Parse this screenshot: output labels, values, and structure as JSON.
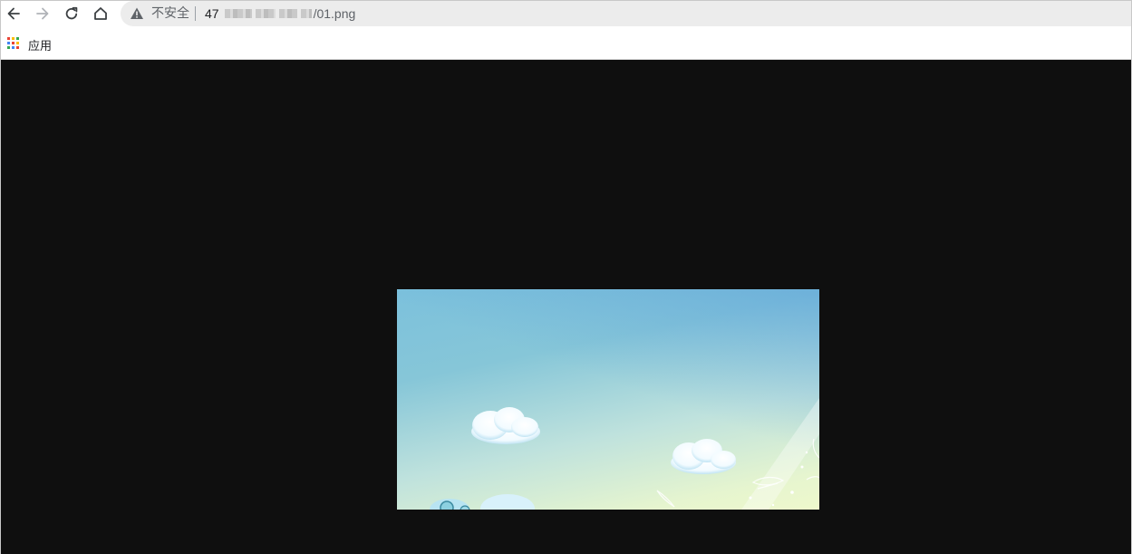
{
  "browser": {
    "nav": {
      "back_icon": "arrow-left-icon",
      "forward_icon": "arrow-right-icon",
      "reload_icon": "reload-icon",
      "home_icon": "home-icon"
    },
    "omnibox": {
      "security_icon": "warning-triangle-icon",
      "security_label": "不安全",
      "url_prefix": "47",
      "url_suffix": "/01.png"
    },
    "bookmarks": {
      "apps_icon": "apps-grid-icon",
      "apps_label": "应用"
    }
  },
  "colors": {
    "viewer_background": "#0f0f0f",
    "toolbar_background": "#ffffff",
    "omnibox_background": "#ececec"
  },
  "image": {
    "content": "sky-with-clouds-illustration"
  }
}
